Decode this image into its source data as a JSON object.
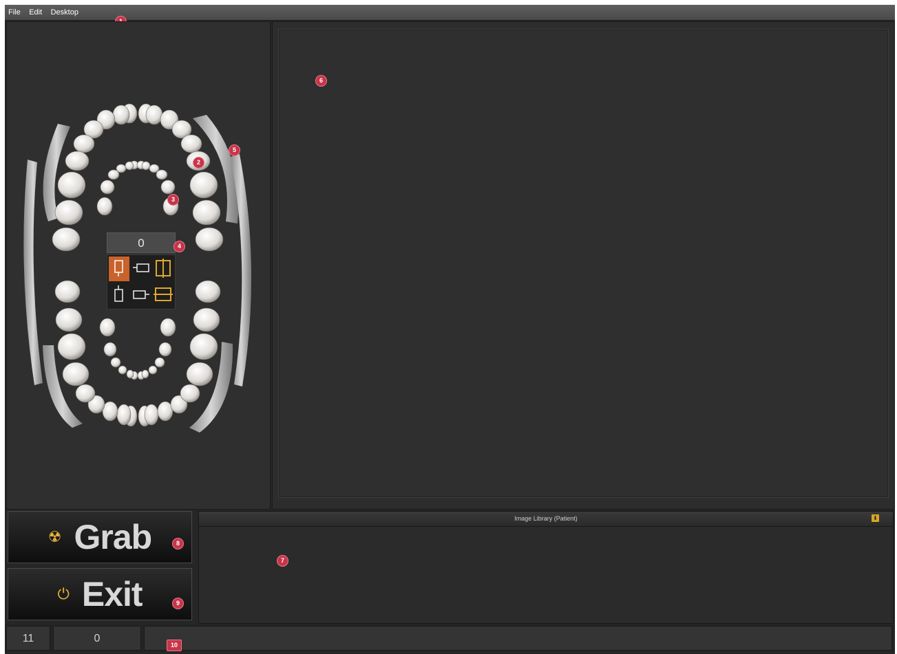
{
  "menu": {
    "items": [
      {
        "label": "File"
      },
      {
        "label": "Edit"
      },
      {
        "label": "Desktop"
      }
    ]
  },
  "badges": {
    "b1": "1",
    "b2": "2",
    "b3": "3",
    "b4": "4",
    "b5": "5",
    "b6": "6",
    "b7": "7",
    "b8": "8",
    "b9": "9",
    "b10": "10"
  },
  "tooth_chart": {
    "image_count": "0",
    "modes": [
      "sensor-vertical-active",
      "sensor-horizontal",
      "bitewing-vertical",
      "sensor-vertical",
      "sensor-horizontal-alt",
      "bitewing-horizontal"
    ]
  },
  "buttons": {
    "grab_label": "Grab",
    "grab_icon": "radiation-icon",
    "exit_label": "Exit",
    "exit_icon": "power-icon"
  },
  "image_library": {
    "title": "Image Library (Patient)",
    "toggle_icon": "arrow-down-icon"
  },
  "status": {
    "cell1": "11",
    "cell2": "0",
    "message": ""
  },
  "colors": {
    "accent": "#e8b43a",
    "badge": "#c7344a",
    "active_mode": "#c9622b"
  }
}
